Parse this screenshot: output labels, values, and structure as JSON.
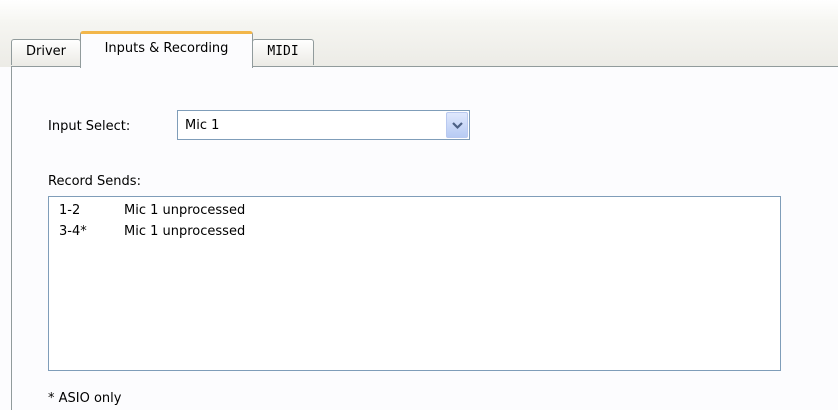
{
  "tabs": [
    {
      "label": "Driver",
      "selected": false
    },
    {
      "label": "Inputs & Recording",
      "selected": true
    },
    {
      "label": "MIDI",
      "selected": false
    }
  ],
  "input_select": {
    "label": "Input Select:",
    "value": "Mic 1"
  },
  "record_sends": {
    "label": "Record Sends:",
    "rows": [
      {
        "channels": "1-2",
        "source": "Mic 1 unprocessed"
      },
      {
        "channels": "3-4*",
        "source": "Mic 1 unprocessed"
      }
    ]
  },
  "footnote": "* ASIO only",
  "colors": {
    "selected_tab_accent": "#f2b64a",
    "border": "#919b9c",
    "field_border": "#7f9db9",
    "dropdown_button": "#b7cbf4"
  },
  "icons": {
    "dropdown": "chevron-down-icon"
  }
}
